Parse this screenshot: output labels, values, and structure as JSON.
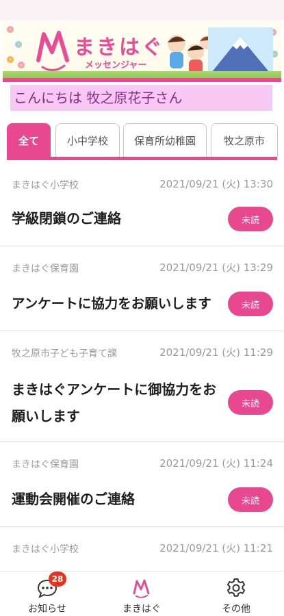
{
  "banner": {
    "title": "まきはぐ",
    "subtitle": "メッセンジャー"
  },
  "greeting": "こんにちは 牧之原花子さん",
  "tabs": [
    {
      "label": "全て",
      "active": true
    },
    {
      "label": "小中学校",
      "active": false
    },
    {
      "label": "保育所幼稚園",
      "active": false
    },
    {
      "label": "牧之原市",
      "active": false
    }
  ],
  "messages": [
    {
      "sender": "まきはぐ小学校",
      "date": "2021/09/21 (火) 13:30",
      "subject": "学級閉鎖のご連絡",
      "status": "未読"
    },
    {
      "sender": "まきはぐ保育園",
      "date": "2021/09/21 (火) 13:29",
      "subject": "アンケートに協力をお願いします",
      "status": "未読"
    },
    {
      "sender": "牧之原市子ども子育て課",
      "date": "2021/09/21 (火) 11:29",
      "subject": "まきはぐアンケートに御協力をお願いします",
      "status": "未読"
    },
    {
      "sender": "まきはぐ保育園",
      "date": "2021/09/21 (火) 11:24",
      "subject": "運動会開催のご連絡",
      "status": "未読"
    },
    {
      "sender": "まきはぐ小学校",
      "date": "2021/09/21 (火) 11:21",
      "subject": "",
      "status": ""
    }
  ],
  "bottom_nav": [
    {
      "label": "お知らせ",
      "icon": "chat-bubble-icon",
      "badge": "28"
    },
    {
      "label": "まきはぐ",
      "icon": "makihagu-logo-icon"
    },
    {
      "label": "その他",
      "icon": "gear-icon"
    }
  ],
  "colors": {
    "accent": "#e8488f",
    "greeting_bg": "#f6c8f3",
    "badge_red": "#e8321f"
  }
}
